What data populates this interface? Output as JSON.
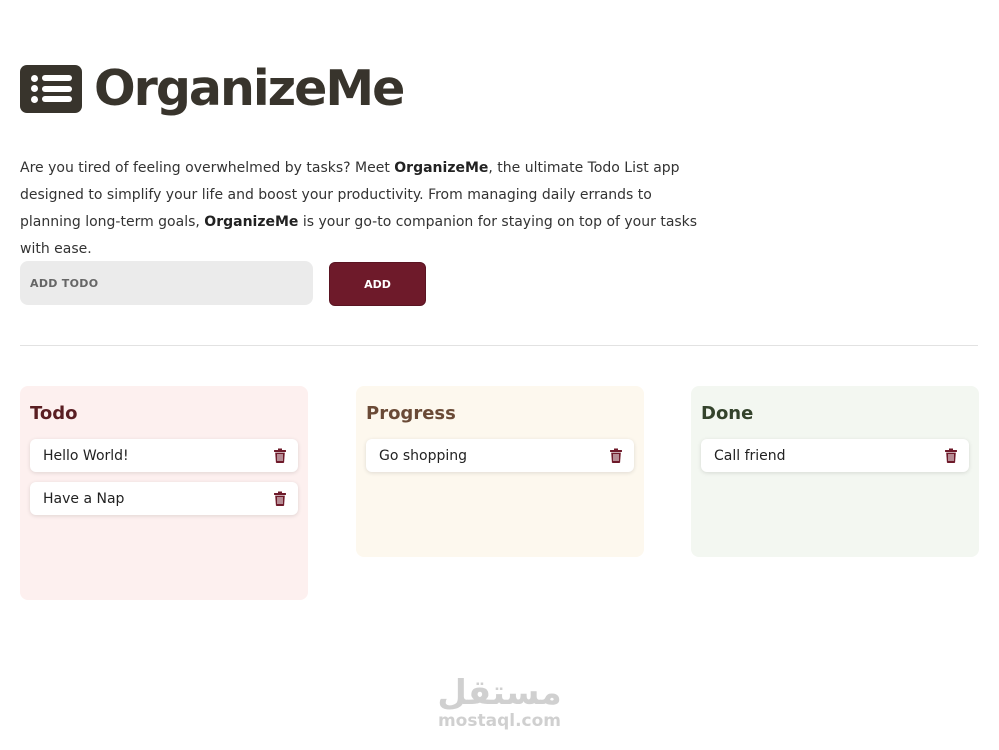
{
  "app": {
    "title": "OrganizeMe",
    "logo_icon": "list-icon"
  },
  "intro": {
    "p1": "Are you tired of feeling overwhelmed by tasks? Meet ",
    "brand1": "OrganizeMe",
    "p2": ", the ultimate Todo List app designed to simplify your life and boost your productivity. From managing daily errands to planning long-term goals, ",
    "brand2": "OrganizeMe",
    "p3": " is your go-to companion for staying on top of your tasks with ease."
  },
  "add_form": {
    "placeholder": "ADD TODO",
    "value": "",
    "button_label": "ADD"
  },
  "columns": {
    "todo": {
      "title": "Todo",
      "items": [
        {
          "text": "Hello World!",
          "icon": "trash-icon"
        },
        {
          "text": "Have a Nap",
          "icon": "trash-icon"
        }
      ]
    },
    "progress": {
      "title": "Progress",
      "items": [
        {
          "text": "Go shopping",
          "icon": "trash-icon"
        }
      ]
    },
    "done": {
      "title": "Done",
      "items": [
        {
          "text": "Call friend",
          "icon": "trash-icon"
        }
      ]
    }
  },
  "watermark": {
    "arabic": "مستقل",
    "latin": "mostaql.com"
  },
  "colors": {
    "text_dark": "#38342c",
    "accent_button": "#6e1a2a",
    "todo_bg": "#fdf0ef",
    "progress_bg": "#fdf8ee",
    "done_bg": "#f3f7f1",
    "trash_icon": "#6e1a2a"
  }
}
